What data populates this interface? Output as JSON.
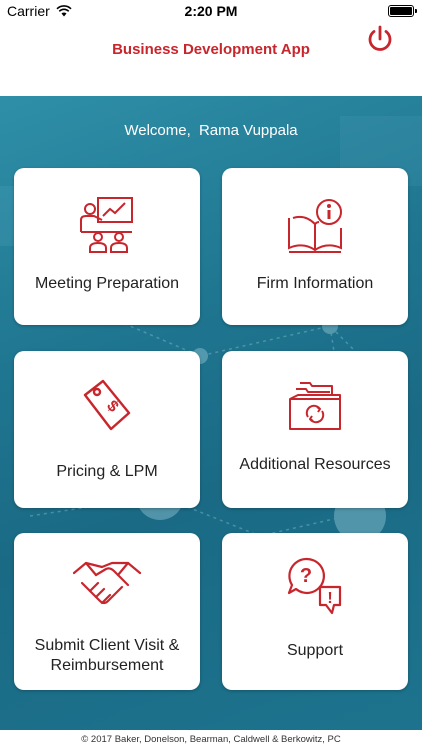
{
  "status_bar": {
    "carrier": "Carrier",
    "time": "2:20 PM"
  },
  "nav": {
    "title": "Business Development App",
    "power_icon": "power-icon"
  },
  "welcome": {
    "greeting": "Welcome,",
    "user_name": "Rama Vuppala"
  },
  "tiles": [
    {
      "label": "Meeting Preparation",
      "icon": "presentation-icon"
    },
    {
      "label": "Firm Information",
      "icon": "book-info-icon"
    },
    {
      "label": "Pricing & LPM",
      "icon": "price-tag-icon"
    },
    {
      "label": "Additional Resources",
      "icon": "file-box-icon"
    },
    {
      "label_line1": "Submit Client Visit &",
      "label_line2": "Reimbursement",
      "icon": "handshake-icon"
    },
    {
      "label": "Support",
      "icon": "support-chat-icon"
    }
  ],
  "footer": {
    "copyright": "© 2017 Baker, Donelson, Bearman, Caldwell & Berkowitz, PC"
  },
  "colors": {
    "accent": "#c8262d",
    "background": "#1f7690"
  }
}
